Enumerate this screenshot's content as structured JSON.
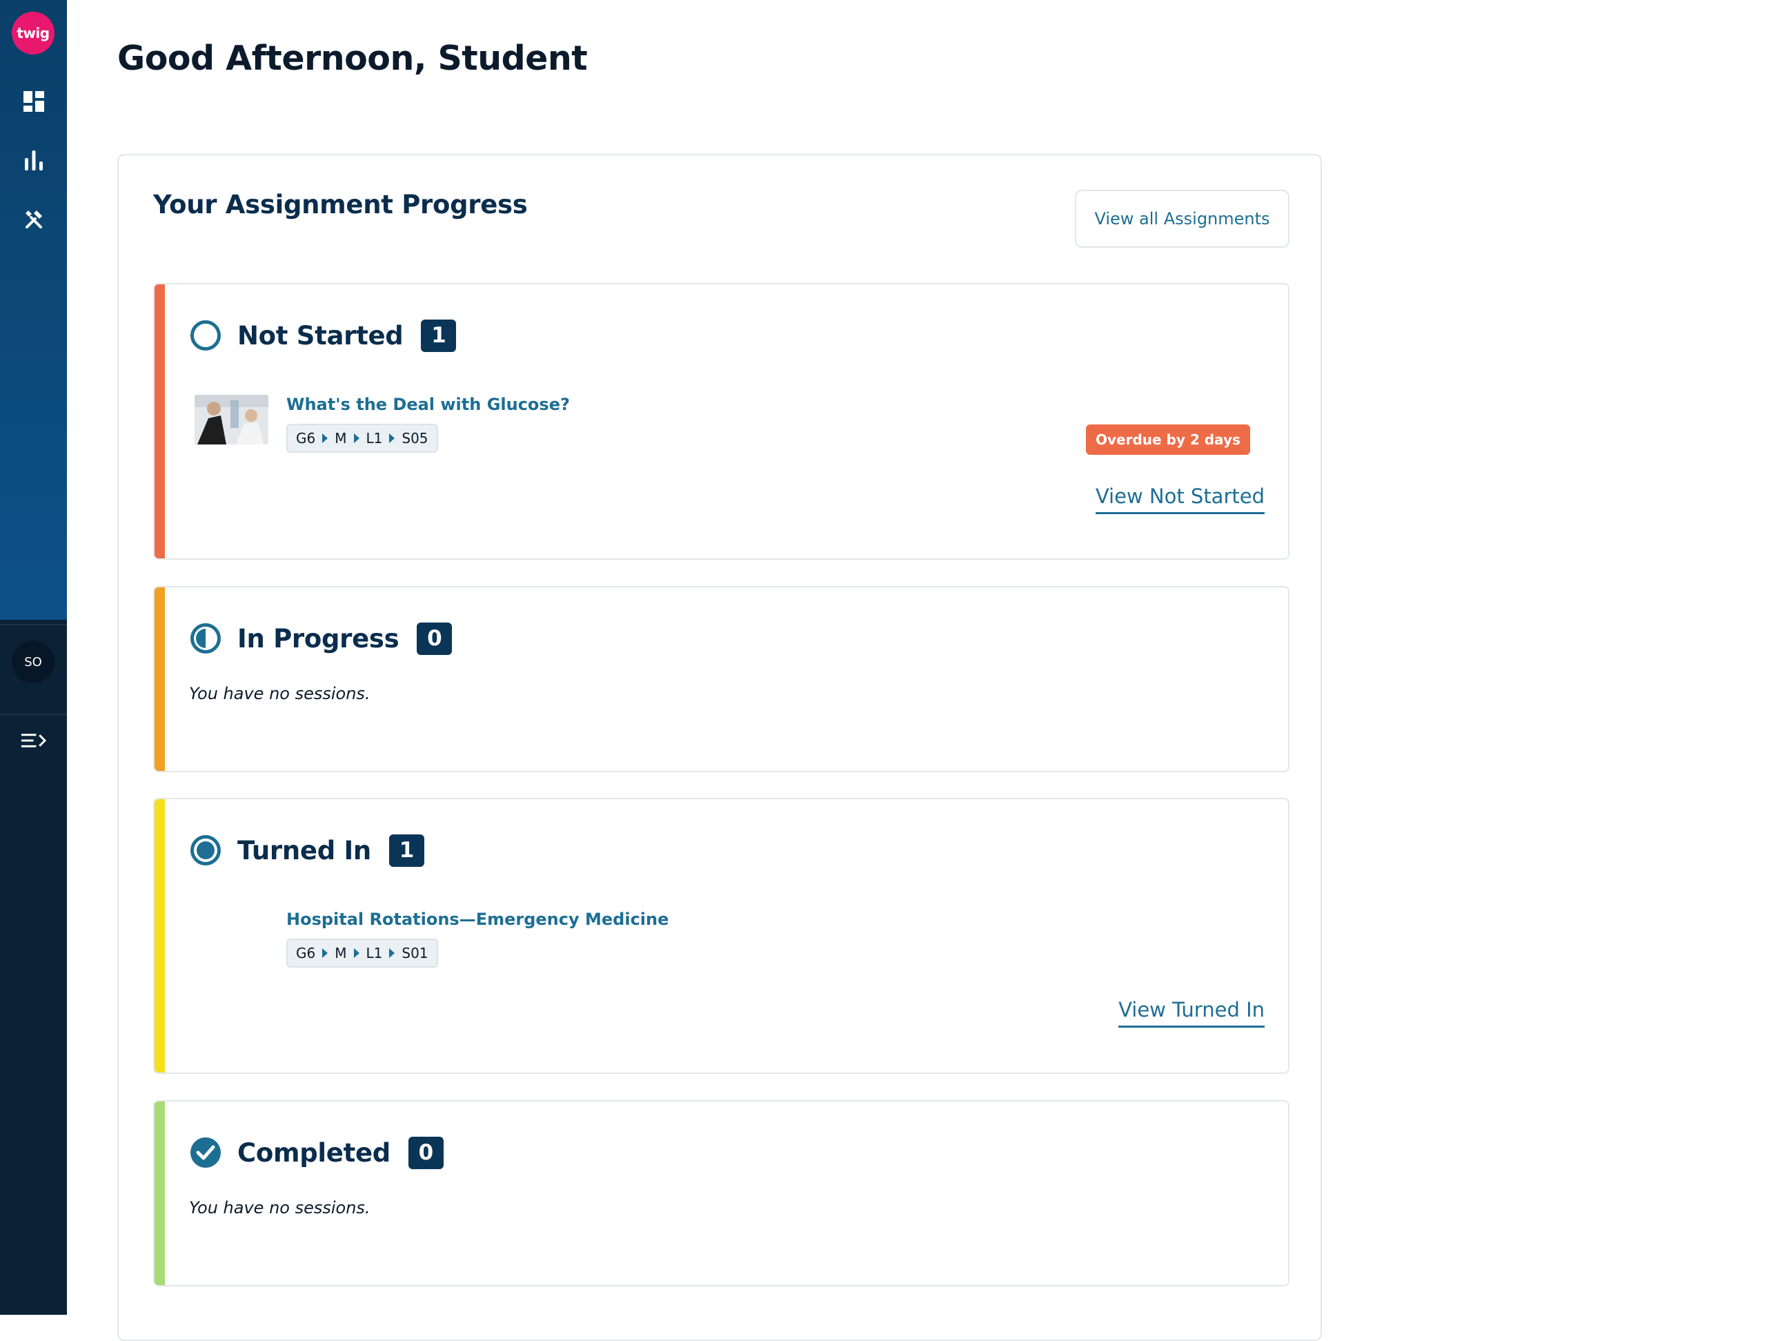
{
  "sidebar": {
    "logo_text": "twig",
    "nav": [
      {
        "name": "dashboard",
        "icon": "dashboard-icon"
      },
      {
        "name": "reports",
        "icon": "bar-chart-icon"
      },
      {
        "name": "tools",
        "icon": "tools-icon"
      }
    ],
    "avatar_initials": "SO",
    "menu_icon": "collapse-menu-icon"
  },
  "header": {
    "greeting": "Good Afternoon, Student"
  },
  "progress_panel": {
    "title": "Your Assignment Progress",
    "view_all_label": "View all Assignments",
    "sections": [
      {
        "title": "Not Started",
        "count": "1",
        "accent": "#ee6b47",
        "items": [
          {
            "title": "What's the Deal with Glucose?",
            "breadcrumb": [
              "G6",
              "M",
              "L1",
              "S05"
            ],
            "badge": "Overdue by 2 days"
          }
        ],
        "link": "View Not Started"
      },
      {
        "title": "In Progress",
        "count": "0",
        "accent": "#f0a123",
        "empty": "You have no sessions."
      },
      {
        "title": "Turned In",
        "count": "1",
        "accent": "#f4e01c",
        "items": [
          {
            "title": "Hospital Rotations—Emergency Medicine",
            "breadcrumb": [
              "G6",
              "M",
              "L1",
              "S01"
            ]
          }
        ],
        "link": "View Turned In"
      },
      {
        "title": "Completed",
        "count": "0",
        "accent": "#a8dc74",
        "empty": "You have no sessions."
      }
    ]
  },
  "colors": {
    "navy": "#0b3557",
    "link": "#1d6e93",
    "brand_pink": "#e8186e"
  }
}
